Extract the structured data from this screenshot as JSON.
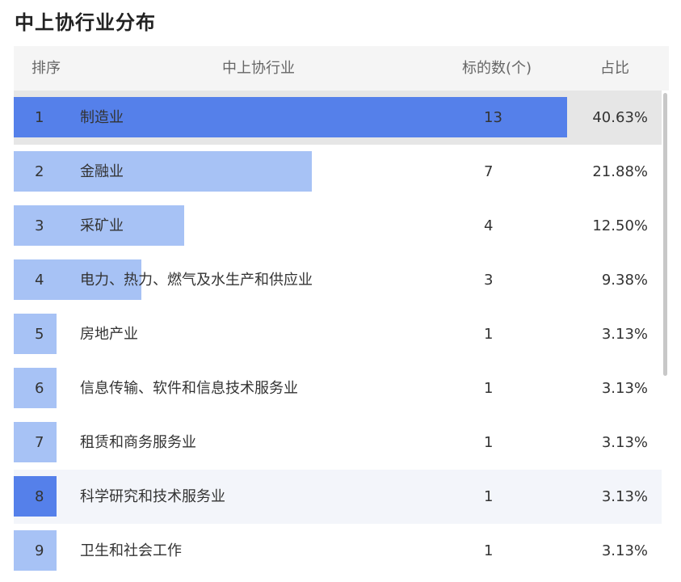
{
  "title": "中上协行业分布",
  "header": {
    "rank": "排序",
    "industry": "中上协行业",
    "count": "标的数(个)",
    "ratio": "占比"
  },
  "colors": {
    "bar_light": "#a7c2f5",
    "bar_strong": "#5580ea",
    "header_bg": "#f5f5f5",
    "row_selected_bg": "#e6e6e6",
    "row_hover_bg": "#f3f5fa"
  },
  "rows": [
    {
      "rank": "1",
      "name": "制造业",
      "count": "13",
      "ratio": "40.63%",
      "share": 0.4063
    },
    {
      "rank": "2",
      "name": "金融业",
      "count": "7",
      "ratio": "21.88%",
      "share": 0.2188
    },
    {
      "rank": "3",
      "name": "采矿业",
      "count": "4",
      "ratio": "12.50%",
      "share": 0.125
    },
    {
      "rank": "4",
      "name": "电力、热力、燃气及水生产和供应业",
      "count": "3",
      "ratio": "9.38%",
      "share": 0.0938
    },
    {
      "rank": "5",
      "name": "房地产业",
      "count": "1",
      "ratio": "3.13%",
      "share": 0.0313
    },
    {
      "rank": "6",
      "name": "信息传输、软件和信息技术服务业",
      "count": "1",
      "ratio": "3.13%",
      "share": 0.0313
    },
    {
      "rank": "7",
      "name": "租赁和商务服务业",
      "count": "1",
      "ratio": "3.13%",
      "share": 0.0313
    },
    {
      "rank": "8",
      "name": "科学研究和技术服务业",
      "count": "1",
      "ratio": "3.13%",
      "share": 0.0313
    },
    {
      "rank": "9",
      "name": "卫生和社会工作",
      "count": "1",
      "ratio": "3.13%",
      "share": 0.0313
    }
  ]
}
